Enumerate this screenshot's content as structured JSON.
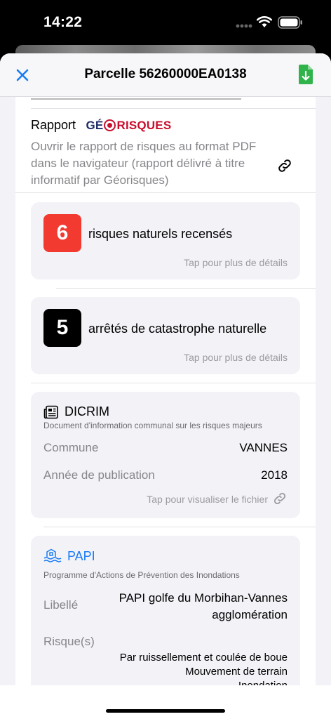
{
  "status_bar": {
    "time": "14:22"
  },
  "nav": {
    "title": "Parcelle 56260000EA0138",
    "close_icon": "close-icon",
    "export_icon": "file-download-icon",
    "accent": "#1a7cf5",
    "export_color": "#2fb34a"
  },
  "rapport": {
    "label": "Rapport",
    "logo_left": "GÉ",
    "logo_right": "RISQUES",
    "description": "Ouvrir le rapport de risques au format PDF dans le navigateur (rapport délivré à titre informatif par Géorisques)"
  },
  "risques": {
    "count": "6",
    "label": "risques naturels recensés",
    "hint": "Tap pour plus de détails",
    "badge_color": "#f23a30"
  },
  "arretes": {
    "count": "5",
    "label": "arrêtés de catastrophe naturelle",
    "hint": "Tap pour plus de détails",
    "badge_color": "#000000"
  },
  "dicrim": {
    "title": "DICRIM",
    "subtitle": "Document d'information communal sur les risques majeurs",
    "commune_label": "Commune",
    "commune_value": "VANNES",
    "annee_label": "Année de publication",
    "annee_value": "2018",
    "hint": "Tap pour visualiser le fichier"
  },
  "papi": {
    "title": "PAPI",
    "subtitle": "Programme d'Actions de Prévention des Inondations",
    "libelle_label": "Libellé",
    "libelle_value": "PAPI golfe du Morbihan-Vannes agglomération",
    "risques_label": "Risque(s)",
    "risques_values": [
      "Par ruissellement et coulée de boue",
      "Mouvement de terrain",
      "Inondation"
    ]
  }
}
